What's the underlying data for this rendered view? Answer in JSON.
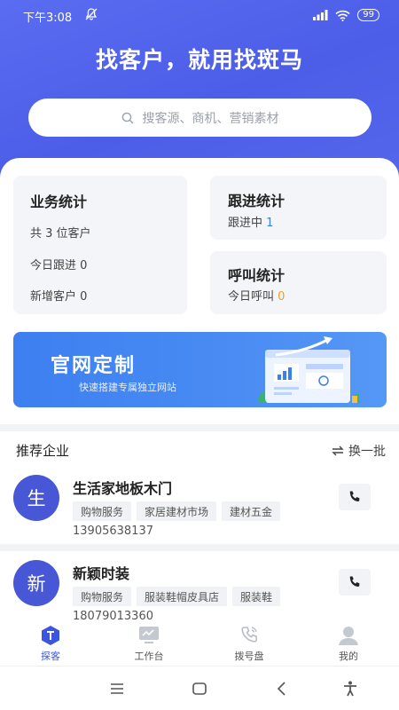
{
  "status": {
    "time": "下午3:08",
    "battery": "99"
  },
  "hero": {
    "title": "找客户，就用找斑马"
  },
  "search": {
    "placeholder": "搜客源、商机、营销素材"
  },
  "stats": {
    "business": {
      "title": "业务统计",
      "total_prefix": "共 ",
      "total_value": "3",
      "total_suffix": " 位客户",
      "followup_label": "今日跟进 ",
      "followup_value": "0",
      "new_label": "新增客户 ",
      "new_value": "0"
    },
    "follow": {
      "title": "跟进统计",
      "label": "跟进中 ",
      "value": "1"
    },
    "call": {
      "title": "呼叫统计",
      "label": "今日呼叫 ",
      "value": "0"
    }
  },
  "banner": {
    "title": "官网定制",
    "subtitle": "快速搭建专属独立网站"
  },
  "recommend": {
    "title": "推荐企业",
    "refresh_label": "换一批",
    "companies": [
      {
        "avatar": "生",
        "name": "生活家地板木门",
        "tags": [
          "购物服务",
          "家居建材市场",
          "建材五金"
        ],
        "phone": "13905638137"
      },
      {
        "avatar": "新",
        "name": "新颖时装",
        "tags": [
          "购物服务",
          "服装鞋帽皮具店",
          "服装鞋"
        ],
        "phone": "18079013360"
      }
    ]
  },
  "tabs": [
    {
      "label": "探客",
      "icon": "explore-icon",
      "active": true
    },
    {
      "label": "工作台",
      "icon": "workbench-icon",
      "active": false
    },
    {
      "label": "拨号盘",
      "icon": "dialpad-icon",
      "active": false
    },
    {
      "label": "我的",
      "icon": "profile-icon",
      "active": false
    }
  ],
  "colors": {
    "brand": "#4c5ee8",
    "accent_blue": "#3b82d6",
    "accent_orange": "#f0a020"
  }
}
